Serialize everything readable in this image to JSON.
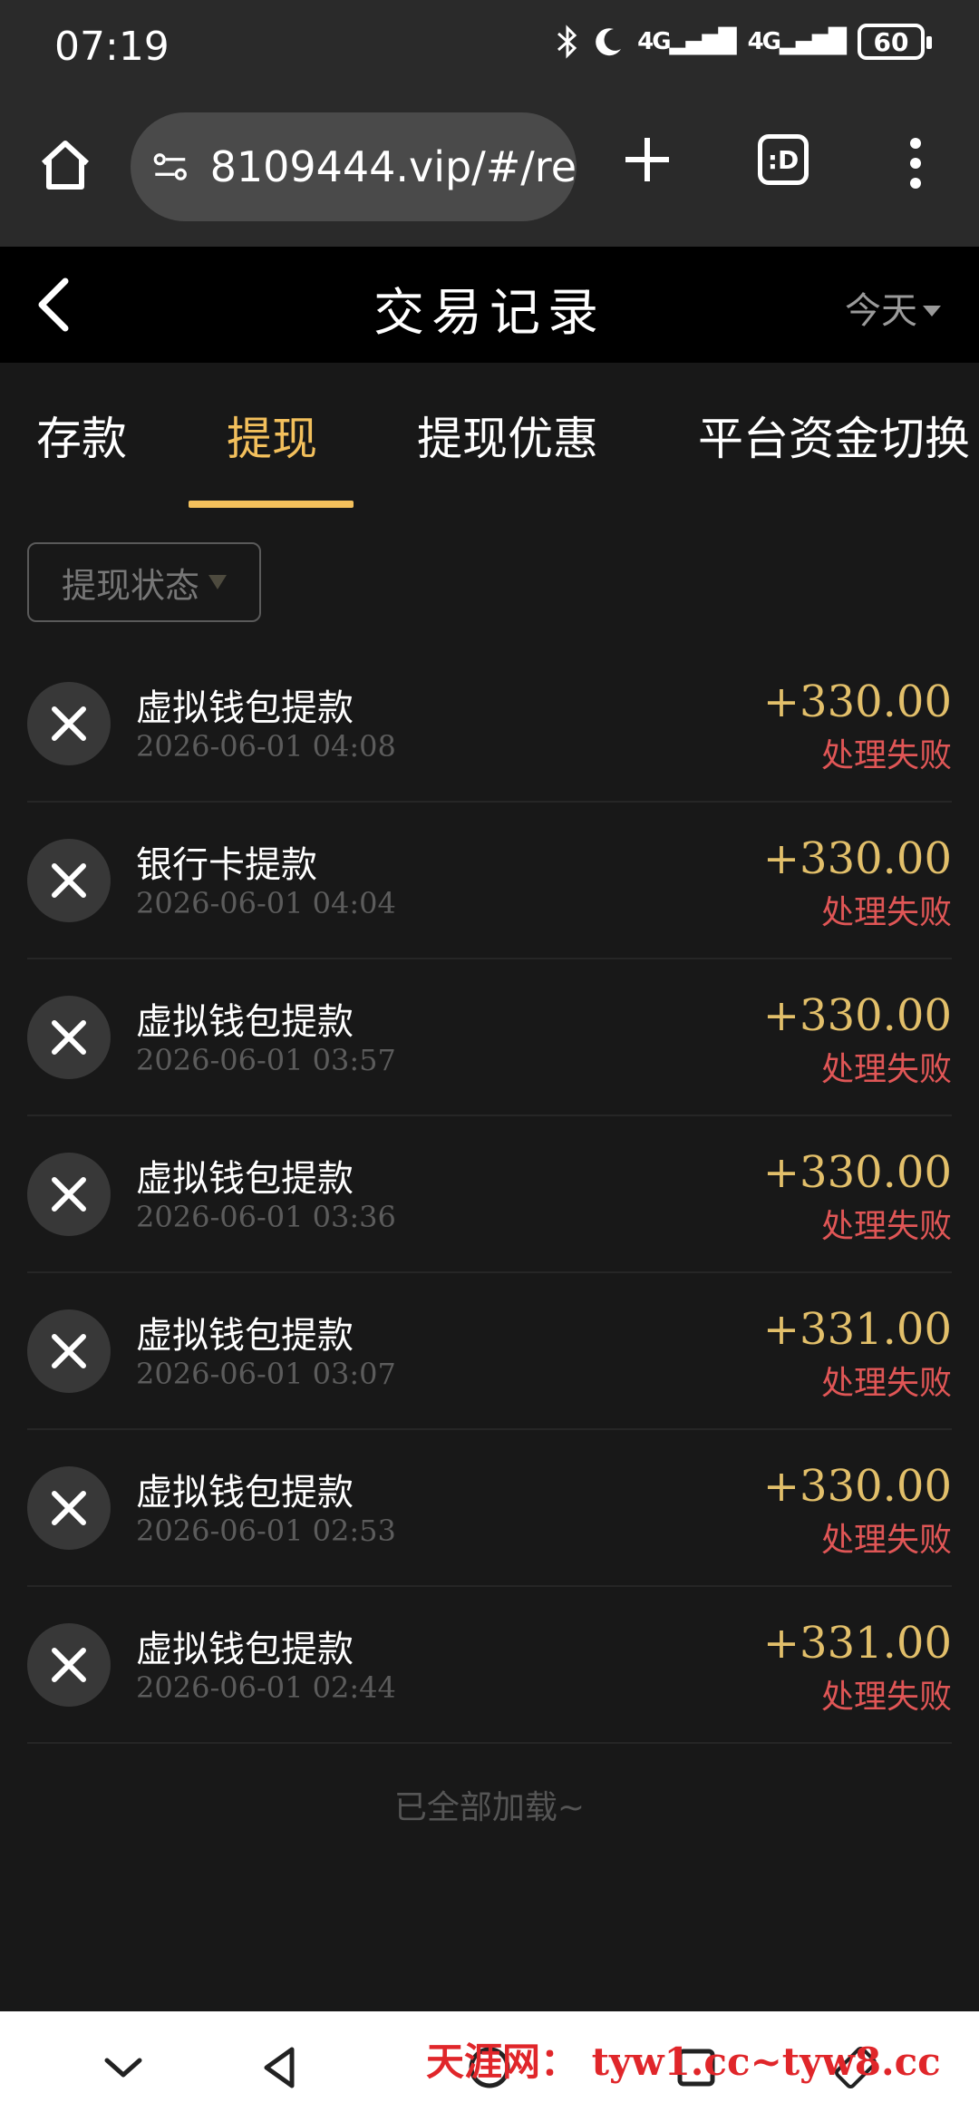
{
  "status_bar": {
    "time": "07:19",
    "network": "4G",
    "battery": "60"
  },
  "browser": {
    "url": "8109444.vip/#/re",
    "tabs_label": ":D"
  },
  "header": {
    "title": "交易记录",
    "range": "今天"
  },
  "tabs": [
    {
      "label": "存款"
    },
    {
      "label": "提现"
    },
    {
      "label": "提现优惠"
    },
    {
      "label": "平台资金切换"
    }
  ],
  "filter": {
    "label": "提现状态"
  },
  "transactions": [
    {
      "name": "虚拟钱包提款",
      "time": "2026-06-01 04:08",
      "amount": "+330.00",
      "status": "处理失败"
    },
    {
      "name": "银行卡提款",
      "time": "2026-06-01 04:04",
      "amount": "+330.00",
      "status": "处理失败"
    },
    {
      "name": "虚拟钱包提款",
      "time": "2026-06-01 03:57",
      "amount": "+330.00",
      "status": "处理失败"
    },
    {
      "name": "虚拟钱包提款",
      "time": "2026-06-01 03:36",
      "amount": "+330.00",
      "status": "处理失败"
    },
    {
      "name": "虚拟钱包提款",
      "time": "2026-06-01 03:07",
      "amount": "+331.00",
      "status": "处理失败"
    },
    {
      "name": "虚拟钱包提款",
      "time": "2026-06-01 02:53",
      "amount": "+330.00",
      "status": "处理失败"
    },
    {
      "name": "虚拟钱包提款",
      "time": "2026-06-01 02:44",
      "amount": "+331.00",
      "status": "处理失败"
    }
  ],
  "end_note": "已全部加载~",
  "watermark": "天涯网： tyw1.cc~tyw8.cc",
  "colors": {
    "accent": "#f3c05c",
    "amount": "#e2bf6a",
    "failed": "#e05656"
  }
}
